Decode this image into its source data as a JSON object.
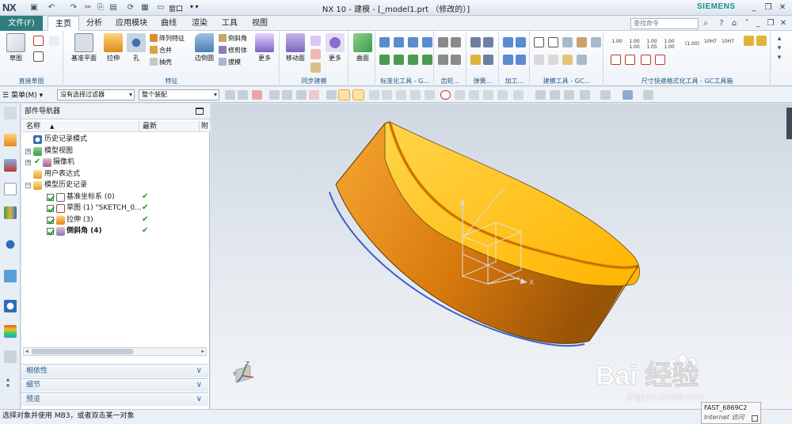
{
  "window": {
    "app_logo": "NX",
    "title": "NX 10 - 建模 - [_model1.prt （修改的）]",
    "brand": "SIEMENS",
    "window_menu": "窗口"
  },
  "menu_tabs": {
    "file": "文件(F)",
    "home": "主页",
    "analysis": "分析",
    "application": "应用模块",
    "curve": "曲线",
    "render": "渲染",
    "tools": "工具",
    "view": "视图"
  },
  "search": {
    "placeholder": "查找命令"
  },
  "ribbon": {
    "sketch": "草图",
    "datum_plane": "基准平面",
    "extrude": "拉伸",
    "hole": "孔",
    "pattern_feature": "阵列特征",
    "unite": "合并",
    "shell": "抽壳",
    "edge_blend": "边倒圆",
    "chamfer": "倒斜角",
    "trim_body": "修剪体",
    "draft": "拔模",
    "more1": "更多",
    "move_face": "移动面",
    "more2": "更多",
    "surface": "曲面",
    "dim_labels": [
      "1.00",
      "1.00",
      "1.00",
      "1.00",
      "(1.00)",
      "10H7",
      "10H7"
    ],
    "dim_sublabels": [
      "",
      "1.00",
      "1.05",
      "1.00",
      "",
      "",
      ""
    ],
    "groups": {
      "direct_sketch": "直接草图",
      "feature": "特征",
      "sync_modeling": "同步建模",
      "std_tools": "标准化工具 - G...",
      "gear": "齿轮...",
      "spring": "弹簧...",
      "machining": "加工...",
      "model_check": "建模工具 - GC...",
      "dimension_quick": "尺寸快速格式化工具 - GC工具箱"
    }
  },
  "cmdbar": {
    "menu_label": "菜单(M)",
    "filter": "没有选择过滤器",
    "assembly": "整个装配"
  },
  "navigator": {
    "title": "部件导航器",
    "col_name": "名称",
    "col_latest": "最新",
    "col_extra": "附",
    "rows": [
      {
        "label": "历史记录模式",
        "latest": ""
      },
      {
        "label": "模型视图",
        "latest": ""
      },
      {
        "label": "摄像机",
        "latest": ""
      },
      {
        "label": "用户表达式",
        "latest": ""
      },
      {
        "label": "模型历史记录",
        "latest": ""
      },
      {
        "label": "基准坐标系 (0)",
        "latest": "✔"
      },
      {
        "label": "草图 (1) \"SKETCH_0...",
        "latest": "✔"
      },
      {
        "label": "拉伸 (3)",
        "latest": "✔"
      },
      {
        "label": "倒斜角 (4)",
        "latest": "✔"
      }
    ],
    "panels": [
      "相依性",
      "细节",
      "预览"
    ]
  },
  "viewport": {
    "csys_axis_x": "X",
    "csys_axis_y": "Y",
    "triad_z": "Z",
    "triad_y": "Y"
  },
  "status": {
    "message": "选择对象并使用 MB3，或者双击某一对象",
    "badge_line1": "FAST_6869C2",
    "badge_line2": "Internet 访问"
  },
  "watermark": {
    "brand": "Bai 经验",
    "url": "jingyan.baidu.com"
  },
  "colors": {
    "file_tab": "#2f7d7d",
    "part_top": "#ffc21a",
    "part_side": "#e07e0c",
    "check_green": "#1aa01a"
  }
}
